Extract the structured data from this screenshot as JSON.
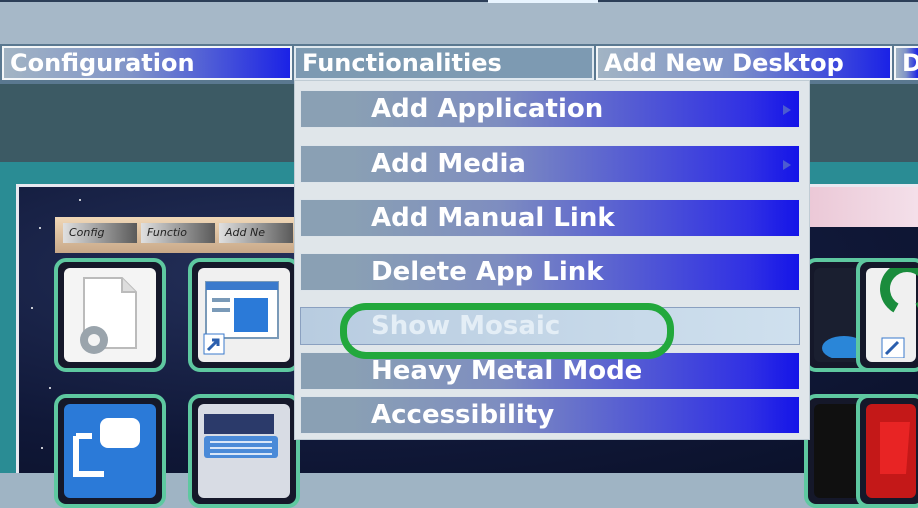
{
  "menubar": {
    "tabs": [
      {
        "label": "Configuration"
      },
      {
        "label": "Functionalities"
      },
      {
        "label": "Add New Desktop"
      },
      {
        "label": "D"
      }
    ]
  },
  "dropdown": {
    "items": [
      {
        "label": "Add Application",
        "has_submenu": true
      },
      {
        "label": "Add Media",
        "has_submenu": true
      },
      {
        "label": "Add Manual Link",
        "has_submenu": false
      },
      {
        "label": "Delete App Link",
        "has_submenu": false
      },
      {
        "label": "Show Mosaic",
        "has_submenu": false,
        "highlighted": true
      },
      {
        "label": "Heavy Metal Mode",
        "has_submenu": false
      },
      {
        "label": "Accessibility",
        "has_submenu": false
      }
    ]
  },
  "preview": {
    "mini_menu": [
      "Config",
      "Functio",
      "Add Ne"
    ]
  },
  "colors": {
    "highlight_ring": "#22a83c",
    "menu_gradient_end": "#1414e8",
    "tile_border": "#5ec8a0"
  }
}
